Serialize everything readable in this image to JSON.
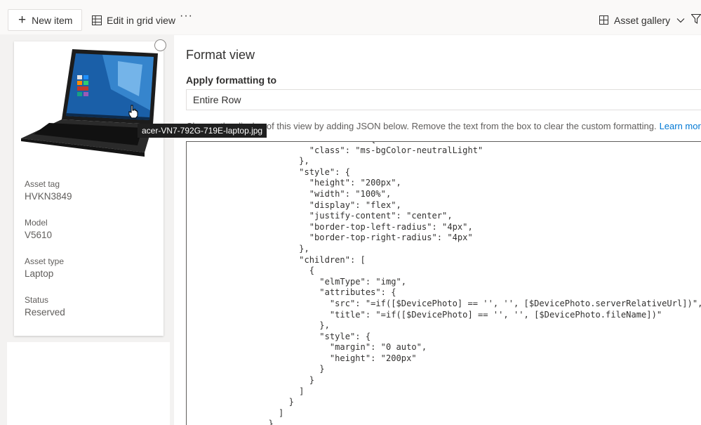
{
  "toolbar": {
    "new_item_label": "New item",
    "edit_grid_label": "Edit in grid view",
    "more_label": "···",
    "view_label": "Asset gallery"
  },
  "card": {
    "tooltip": "acer-VN7-792G-719E-laptop.jpg",
    "fields": [
      {
        "label": "Asset tag",
        "value": "HVKN3849"
      },
      {
        "label": "Model",
        "value": "V5610"
      },
      {
        "label": "Asset type",
        "value": "Laptop"
      },
      {
        "label": "Status",
        "value": "Reserved"
      }
    ]
  },
  "panel": {
    "title": "Format view",
    "apply_label": "Apply formatting to",
    "apply_value": "Entire Row",
    "description": "Change the display of this view by adding JSON below. Remove the text from the box to clear the custom formatting.",
    "learn_more": "Learn more",
    "code_lines": [
      "                      \"attributes\": {",
      "                        \"class\": \"ms-bgColor-neutralLight\"",
      "                      },",
      "                      \"style\": {",
      "                        \"height\": \"200px\",",
      "                        \"width\": \"100%\",",
      "                        \"display\": \"flex\",",
      "                        \"justify-content\": \"center\",",
      "                        \"border-top-left-radius\": \"4px\",",
      "                        \"border-top-right-radius\": \"4px\"",
      "                      },",
      "                      \"children\": [",
      "                        {",
      "                          \"elmType\": \"img\",",
      "                          \"attributes\": {",
      "                            \"src\": \"=if([$DevicePhoto] == '', '', [$DevicePhoto.serverRelativeUrl])\",",
      "                            \"title\": \"=if([$DevicePhoto] == '', '', [$DevicePhoto.fileName])\"",
      "                          },",
      "                          \"style\": {",
      "                            \"margin\": \"0 auto\",",
      "                            \"height\": \"200px\"",
      "                          }",
      "                        }",
      "                      ]",
      "                    }",
      "                  ]",
      "                }"
    ]
  },
  "colors": {
    "accent": "#0078d4",
    "tooltip_bg": "#1f1f1f"
  }
}
